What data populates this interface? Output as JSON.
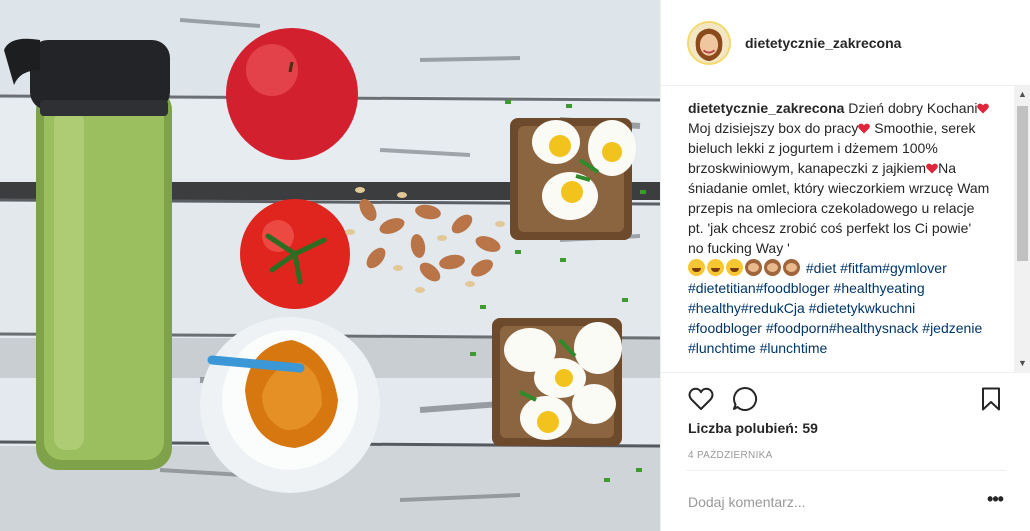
{
  "post": {
    "username": "dietetycznie_zakrecona",
    "caption": {
      "username": "dietetycznie_zakrecona",
      "text_1": " Dzień dobry Kochani",
      "text_2": "Moj dzisiejszy box do pracy",
      "text_3": " Smoothie, serek bieluch lekki z jogurtem i dżemem 100% brzoskwiniowym, kanapeczki z jajkiem",
      "text_4": "Na śniadanie omlet, który wieczorkiem wrzucę Wam przepis na omleciora czekoladowego u relacje pt. 'jak chcesz zrobić coś perfekt los Ci powie' no fucking Way '",
      "tags_line": " #diet #fitfam#gymlover #dietetitian#foodbloger #healthyeating #healthy#redukCja #dietetykwkuchni #foodbloger #foodporn#healthysnack #jedzenie #lunchtime #lunchtime"
    },
    "likes_label": "Liczba polubień: 59",
    "date": "4 PAŹDZIERNIKA",
    "comment_placeholder": "Dodaj komentarz...",
    "more_label": "•••"
  },
  "icons": {
    "heart": "heart-icon",
    "comment": "comment-icon",
    "bookmark": "bookmark-icon",
    "red_heart": "red-heart-emoji",
    "laugh": "laughing-emoji",
    "monkey": "see-no-evil-monkey-emoji"
  },
  "colors": {
    "hashtag": "#003569",
    "text": "#262626",
    "muted": "#999999",
    "divider": "#efefef"
  }
}
